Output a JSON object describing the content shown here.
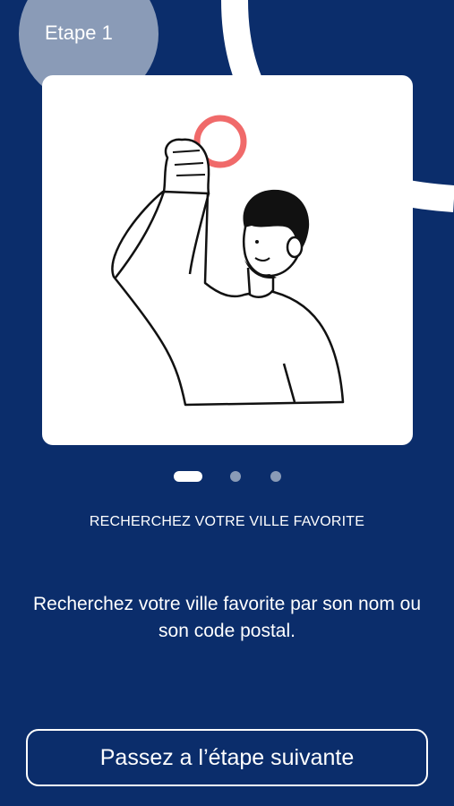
{
  "step": {
    "label": "Etape 1"
  },
  "pager": {
    "active_index": 0,
    "total": 3
  },
  "onboarding": {
    "title": "RECHERCHEZ VOTRE VILLE FAVORITE",
    "description": "Recherchez votre ville favorite par son nom ou son code postal."
  },
  "actions": {
    "next_label": "Passez a l’étape suivante"
  },
  "colors": {
    "background": "#0b2d6b",
    "badge": "#8a9bb7",
    "accent": "#f06a6a"
  }
}
